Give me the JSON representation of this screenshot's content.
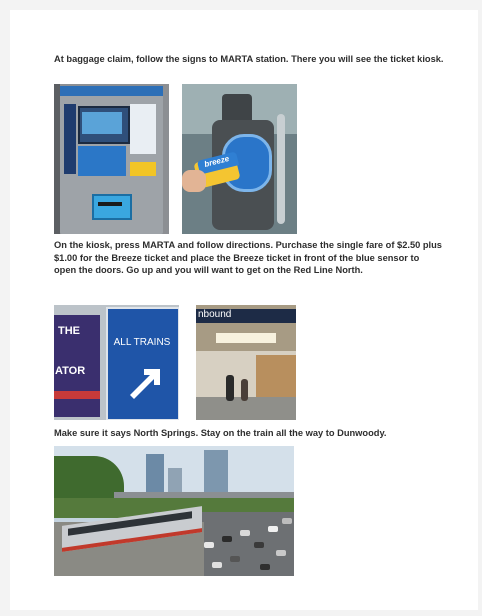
{
  "paragraphs": {
    "p1": "At baggage claim, follow the signs to MARTA station. There you will see the ticket kiosk.",
    "p2": "On the kiosk, press MARTA and follow directions.  Purchase the single fare of $2.50 plus $1.00 for the Breeze ticket and place the Breeze ticket in front of the blue sensor to open the doors. Go up and you will want to get on the Red Line North.",
    "p3": "Make sure it says North Springs.  Stay on the train all the way to Dunwoody."
  },
  "photo_text": {
    "breeze_card": "breeze",
    "sign_left_top": "THE",
    "sign_left_bottom": "ATOR",
    "sign_main": "ALL TRAINS",
    "station_sign": "nbound"
  },
  "colors": {
    "marta_blue": "#1f55a8",
    "breeze_yellow": "#f4c531",
    "red_line": "#c1392b"
  }
}
